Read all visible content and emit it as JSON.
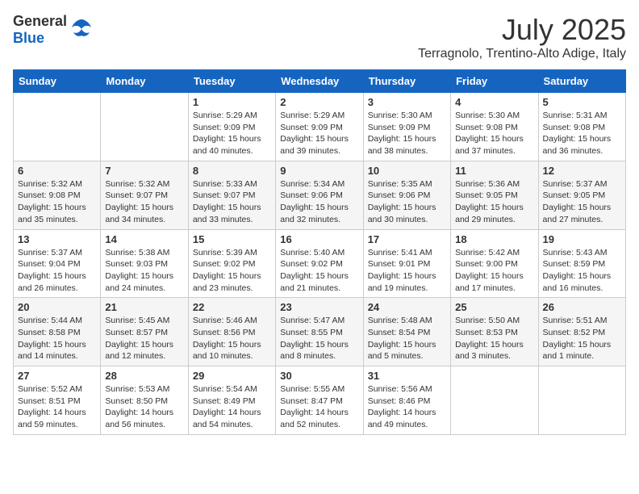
{
  "header": {
    "logo_general": "General",
    "logo_blue": "Blue",
    "month": "July 2025",
    "location": "Terragnolo, Trentino-Alto Adige, Italy"
  },
  "days_of_week": [
    "Sunday",
    "Monday",
    "Tuesday",
    "Wednesday",
    "Thursday",
    "Friday",
    "Saturday"
  ],
  "weeks": [
    [
      {
        "day": "",
        "info": ""
      },
      {
        "day": "",
        "info": ""
      },
      {
        "day": "1",
        "info": "Sunrise: 5:29 AM\nSunset: 9:09 PM\nDaylight: 15 hours and 40 minutes."
      },
      {
        "day": "2",
        "info": "Sunrise: 5:29 AM\nSunset: 9:09 PM\nDaylight: 15 hours and 39 minutes."
      },
      {
        "day": "3",
        "info": "Sunrise: 5:30 AM\nSunset: 9:09 PM\nDaylight: 15 hours and 38 minutes."
      },
      {
        "day": "4",
        "info": "Sunrise: 5:30 AM\nSunset: 9:08 PM\nDaylight: 15 hours and 37 minutes."
      },
      {
        "day": "5",
        "info": "Sunrise: 5:31 AM\nSunset: 9:08 PM\nDaylight: 15 hours and 36 minutes."
      }
    ],
    [
      {
        "day": "6",
        "info": "Sunrise: 5:32 AM\nSunset: 9:08 PM\nDaylight: 15 hours and 35 minutes."
      },
      {
        "day": "7",
        "info": "Sunrise: 5:32 AM\nSunset: 9:07 PM\nDaylight: 15 hours and 34 minutes."
      },
      {
        "day": "8",
        "info": "Sunrise: 5:33 AM\nSunset: 9:07 PM\nDaylight: 15 hours and 33 minutes."
      },
      {
        "day": "9",
        "info": "Sunrise: 5:34 AM\nSunset: 9:06 PM\nDaylight: 15 hours and 32 minutes."
      },
      {
        "day": "10",
        "info": "Sunrise: 5:35 AM\nSunset: 9:06 PM\nDaylight: 15 hours and 30 minutes."
      },
      {
        "day": "11",
        "info": "Sunrise: 5:36 AM\nSunset: 9:05 PM\nDaylight: 15 hours and 29 minutes."
      },
      {
        "day": "12",
        "info": "Sunrise: 5:37 AM\nSunset: 9:05 PM\nDaylight: 15 hours and 27 minutes."
      }
    ],
    [
      {
        "day": "13",
        "info": "Sunrise: 5:37 AM\nSunset: 9:04 PM\nDaylight: 15 hours and 26 minutes."
      },
      {
        "day": "14",
        "info": "Sunrise: 5:38 AM\nSunset: 9:03 PM\nDaylight: 15 hours and 24 minutes."
      },
      {
        "day": "15",
        "info": "Sunrise: 5:39 AM\nSunset: 9:02 PM\nDaylight: 15 hours and 23 minutes."
      },
      {
        "day": "16",
        "info": "Sunrise: 5:40 AM\nSunset: 9:02 PM\nDaylight: 15 hours and 21 minutes."
      },
      {
        "day": "17",
        "info": "Sunrise: 5:41 AM\nSunset: 9:01 PM\nDaylight: 15 hours and 19 minutes."
      },
      {
        "day": "18",
        "info": "Sunrise: 5:42 AM\nSunset: 9:00 PM\nDaylight: 15 hours and 17 minutes."
      },
      {
        "day": "19",
        "info": "Sunrise: 5:43 AM\nSunset: 8:59 PM\nDaylight: 15 hours and 16 minutes."
      }
    ],
    [
      {
        "day": "20",
        "info": "Sunrise: 5:44 AM\nSunset: 8:58 PM\nDaylight: 15 hours and 14 minutes."
      },
      {
        "day": "21",
        "info": "Sunrise: 5:45 AM\nSunset: 8:57 PM\nDaylight: 15 hours and 12 minutes."
      },
      {
        "day": "22",
        "info": "Sunrise: 5:46 AM\nSunset: 8:56 PM\nDaylight: 15 hours and 10 minutes."
      },
      {
        "day": "23",
        "info": "Sunrise: 5:47 AM\nSunset: 8:55 PM\nDaylight: 15 hours and 8 minutes."
      },
      {
        "day": "24",
        "info": "Sunrise: 5:48 AM\nSunset: 8:54 PM\nDaylight: 15 hours and 5 minutes."
      },
      {
        "day": "25",
        "info": "Sunrise: 5:50 AM\nSunset: 8:53 PM\nDaylight: 15 hours and 3 minutes."
      },
      {
        "day": "26",
        "info": "Sunrise: 5:51 AM\nSunset: 8:52 PM\nDaylight: 15 hours and 1 minute."
      }
    ],
    [
      {
        "day": "27",
        "info": "Sunrise: 5:52 AM\nSunset: 8:51 PM\nDaylight: 14 hours and 59 minutes."
      },
      {
        "day": "28",
        "info": "Sunrise: 5:53 AM\nSunset: 8:50 PM\nDaylight: 14 hours and 56 minutes."
      },
      {
        "day": "29",
        "info": "Sunrise: 5:54 AM\nSunset: 8:49 PM\nDaylight: 14 hours and 54 minutes."
      },
      {
        "day": "30",
        "info": "Sunrise: 5:55 AM\nSunset: 8:47 PM\nDaylight: 14 hours and 52 minutes."
      },
      {
        "day": "31",
        "info": "Sunrise: 5:56 AM\nSunset: 8:46 PM\nDaylight: 14 hours and 49 minutes."
      },
      {
        "day": "",
        "info": ""
      },
      {
        "day": "",
        "info": ""
      }
    ]
  ]
}
